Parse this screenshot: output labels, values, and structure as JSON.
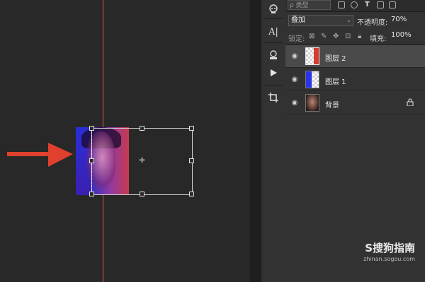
{
  "canvas": {
    "guide_color": "#e05a3e",
    "arrow_color": "#e0402e"
  },
  "toolstrip": {
    "tools": [
      {
        "name": "alien-icon",
        "glyph": "☻"
      },
      {
        "name": "type-panel-icon",
        "glyph": "A|"
      },
      {
        "name": "info-icon",
        "glyph": "⊞"
      },
      {
        "name": "play-icon",
        "glyph": "▶"
      },
      {
        "name": "crop-icon",
        "glyph": "⌗"
      }
    ]
  },
  "layers_panel": {
    "search_placeholder": "ρ 类型",
    "blend_mode": "叠加",
    "opacity_label": "不透明度:",
    "opacity_value": "70%",
    "lock_label": "锁定:",
    "fill_label": "填充:",
    "fill_value": "100%",
    "layers": [
      {
        "name": "图层 2",
        "selected": true,
        "thumb": "red-half",
        "locked": false
      },
      {
        "name": "图层 1",
        "selected": false,
        "thumb": "blue-half",
        "locked": false
      },
      {
        "name": "背景",
        "selected": false,
        "thumb": "portrait",
        "locked": true
      }
    ]
  },
  "watermark": {
    "main": "S搜狗指南",
    "sub": "zhinan.sogou.com"
  }
}
